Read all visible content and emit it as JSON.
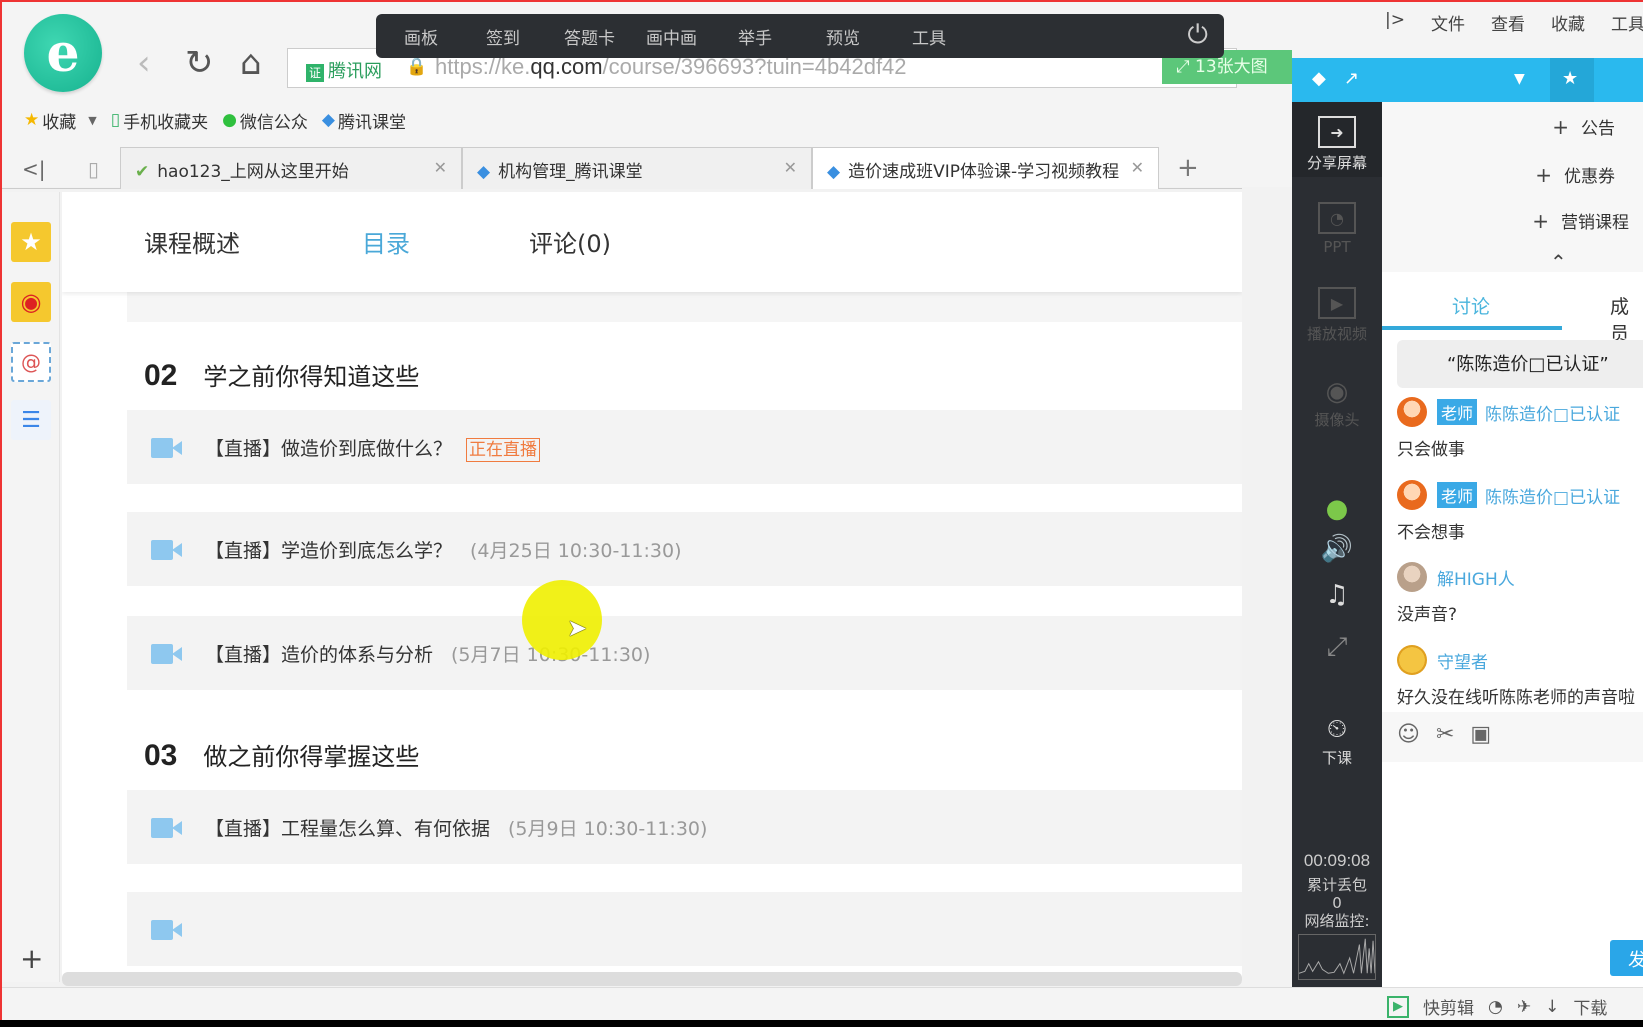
{
  "live_toolbar": {
    "items": [
      "画板",
      "签到",
      "答题卡",
      "画中画",
      "举手",
      "预览",
      "工具"
    ],
    "power_icon": "power-icon"
  },
  "browser": {
    "menu": [
      "文件",
      "查看",
      "收藏",
      "工具"
    ],
    "menu_expand_icon": "|>",
    "address": {
      "cert_label": "腾讯网",
      "url_prefix": "https://ke.",
      "url_domain": "qq.com",
      "url_path": "/course/396693?tuin=4b42df42"
    },
    "big_image_label": "13张大图",
    "bookmarks": [
      {
        "icon": "star-icon",
        "label": "收藏"
      },
      {
        "icon": "phone-icon",
        "label": "手机收藏夹"
      },
      {
        "icon": "wechat-icon",
        "label": "微信公众"
      },
      {
        "icon": "tencent-classroom-icon",
        "label": "腾讯课堂"
      }
    ],
    "tabs": [
      {
        "label": "hao123_上网从这里开始",
        "active": false
      },
      {
        "label": "机构管理_腾讯课堂",
        "active": false
      },
      {
        "label": "造价速成班VIP体验课-学习视频教程",
        "active": true
      }
    ]
  },
  "page": {
    "subnav": {
      "items": [
        "课程概述",
        "目录",
        "评论(0)"
      ],
      "active_index": 1
    },
    "sections": [
      {
        "num": "02",
        "title": "学之前你得知道这些",
        "lessons": [
          {
            "label": "【直播】做造价到底做什么？",
            "time": "",
            "badge": "正在直播"
          },
          {
            "label": "【直播】学造价到底怎么学？",
            "time": "(4月25日 10:30-11:30)",
            "badge": ""
          },
          {
            "label": "【直播】造价的体系与分析",
            "time": "(5月7日 10:30-11:30)",
            "badge": ""
          }
        ]
      },
      {
        "num": "03",
        "title": "做之前你得掌握这些",
        "lessons": [
          {
            "label": "【直播】工程量怎么算、有何依据",
            "time": "(5月9日 10:30-11:30)",
            "badge": ""
          }
        ]
      }
    ]
  },
  "live_panel": {
    "side_tools": [
      {
        "icon": "share-screen-icon",
        "label": "分享屏幕",
        "enabled": true
      },
      {
        "icon": "ppt-icon",
        "label": "PPT",
        "enabled": false
      },
      {
        "icon": "play-video-icon",
        "label": "播放视频",
        "enabled": false
      },
      {
        "icon": "camera-icon",
        "label": "摄像头",
        "enabled": false
      }
    ],
    "end_class_label": "下课",
    "timer": "00:09:08",
    "packet_loss_label": "累计丢包",
    "packet_loss_value": "0",
    "network_label": "网络监控:",
    "add_items": [
      "公告",
      "优惠券",
      "营销课程"
    ],
    "tabs": [
      "讨论",
      "成员"
    ],
    "active_tab": 0,
    "pinned_message": "“陈陈造价□已认证”",
    "messages": [
      {
        "role": "老师",
        "name": "陈陈造价□已认证",
        "text": "只会做事",
        "avatar": "teacher"
      },
      {
        "role": "老师",
        "name": "陈陈造价□已认证",
        "text": "不会想事",
        "avatar": "teacher"
      },
      {
        "role": "",
        "name": "解HIGH人",
        "text": "没声音?",
        "avatar": "user"
      },
      {
        "role": "",
        "name": "守望者",
        "text": "好久没在线听陈陈老师的声音啦",
        "avatar": "sun"
      }
    ],
    "send_label": "发送"
  },
  "statusbar": {
    "items": [
      "快剪辑",
      "下载"
    ]
  },
  "colors": {
    "accent": "#2ab9ee",
    "link": "#4aa8dd",
    "live_badge": "#f07b3f",
    "dark_panel": "#2b2e33"
  }
}
